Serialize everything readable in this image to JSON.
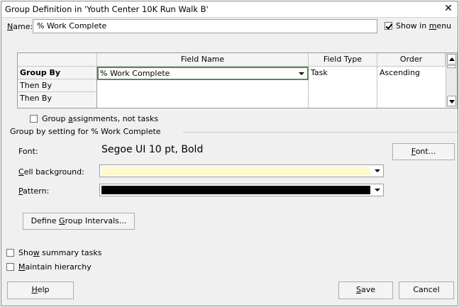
{
  "dialog": {
    "title": "Group Definition in 'Youth Center 10K Run Walk B'",
    "name_label_prefix": "",
    "name_label_key": "N",
    "name_label_rest": "ame:",
    "name_value": "% Work Complete",
    "show_in_menu_label_pre": "Show in ",
    "show_in_menu_label_key": "m",
    "show_in_menu_label_post": "enu",
    "show_in_menu_checked": true
  },
  "grid": {
    "headers": [
      "Field Name",
      "Field Type",
      "Order"
    ],
    "rows": [
      {
        "label": "Group By",
        "field_name": "% Work Complete",
        "field_type": "Task",
        "order": "Ascending"
      },
      {
        "label": "Then By",
        "field_name": "",
        "field_type": "",
        "order": ""
      },
      {
        "label": "Then By",
        "field_name": "",
        "field_type": "",
        "order": ""
      }
    ]
  },
  "group_assignments": {
    "label_pre": "Group ",
    "label_key": "a",
    "label_post": "ssignments, not tasks",
    "checked": false
  },
  "group_setting": {
    "legend": "Group by setting for % Work Complete",
    "font_label": "Font:",
    "font_value": "Segoe UI 10 pt, Bold",
    "font_button_key": "F",
    "font_button_rest": "ont...",
    "cell_bg_label_key": "C",
    "cell_bg_label_rest": "ell background:",
    "cell_bg_color": "#fffacd",
    "pattern_label_key": "P",
    "pattern_label_rest": "attern:",
    "pattern_color": "#000000",
    "define_intervals_pre": "Define ",
    "define_intervals_key": "G",
    "define_intervals_post": "roup Intervals..."
  },
  "options": {
    "show_summary_pre": "Sho",
    "show_summary_key": "w",
    "show_summary_post": " summary tasks",
    "show_summary_checked": false,
    "maintain_key": "M",
    "maintain_rest": "aintain hierarchy",
    "maintain_checked": false
  },
  "buttons": {
    "help_key": "H",
    "help_rest": "elp",
    "save_key": "S",
    "save_rest": "ave",
    "cancel": "Cancel"
  }
}
